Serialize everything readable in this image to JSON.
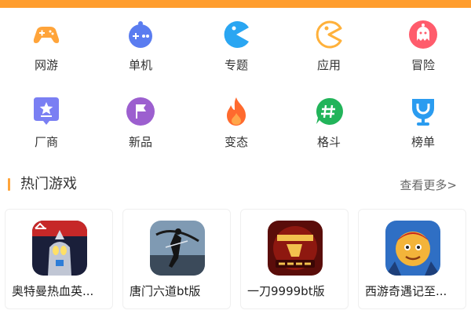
{
  "colors": {
    "accent": "#ff9d2e",
    "section_bar": "#ffa43a"
  },
  "categories": [
    {
      "label": "网游",
      "icon": "gamepad-icon",
      "color": "#ffa43a"
    },
    {
      "label": "单机",
      "icon": "joystick-icon",
      "color": "#5a7cf0"
    },
    {
      "label": "专题",
      "icon": "pacman-icon",
      "color": "#2aa6f2"
    },
    {
      "label": "应用",
      "icon": "pacman-outline-icon",
      "color": "#ffb13b"
    },
    {
      "label": "冒险",
      "icon": "ghost-icon",
      "color": "#ff5c6c"
    },
    {
      "label": "厂商",
      "icon": "star-badge-icon",
      "color": "#7a7ff3"
    },
    {
      "label": "新品",
      "icon": "flag-icon",
      "color": "#9c5fcf"
    },
    {
      "label": "变态",
      "icon": "flame-icon",
      "color": "#ff6a2e"
    },
    {
      "label": "格斗",
      "icon": "hashtag-chat-icon",
      "color": "#22b45a"
    },
    {
      "label": "榜单",
      "icon": "trophy-icon",
      "color": "#2b9cf0"
    }
  ],
  "section": {
    "title": "热门游戏",
    "more": "查看更多>"
  },
  "games": [
    {
      "name": "奥特曼热血英...",
      "icon": "ultraman-game-icon"
    },
    {
      "name": "唐门六道bt版",
      "icon": "tangmen-game-icon"
    },
    {
      "name": "一刀9999bt版",
      "icon": "yidao-game-icon"
    },
    {
      "name": "西游奇遇记至...",
      "icon": "xiyou-game-icon"
    }
  ]
}
